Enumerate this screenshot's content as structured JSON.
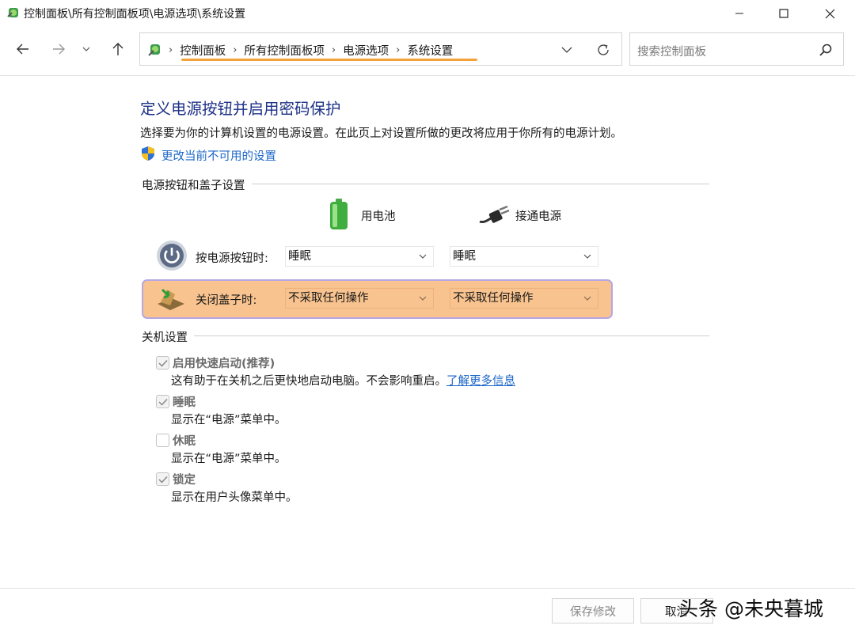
{
  "window": {
    "title": "控制面板\\所有控制面板项\\电源选项\\系统设置"
  },
  "nav": {
    "crumbs": [
      "控制面板",
      "所有控制面板项",
      "电源选项",
      "系统设置"
    ],
    "search_placeholder": "搜索控制面板"
  },
  "main": {
    "heading": "定义电源按钮并启用密码保护",
    "description": "选择要为你的计算机设置的电源设置。在此页上对设置所做的更改将应用于你所有的电源计划。",
    "change_link": "更改当前不可用的设置"
  },
  "power_section": {
    "title": "电源按钮和盖子设置",
    "col_battery": "用电池",
    "col_plugged": "接通电源",
    "rows": [
      {
        "label": "按电源按钮时:",
        "battery": "睡眠",
        "plugged": "睡眠"
      },
      {
        "label": "关闭盖子时:",
        "battery": "不采取任何操作",
        "plugged": "不采取任何操作"
      }
    ]
  },
  "shutdown_section": {
    "title": "关机设置",
    "items": [
      {
        "label": "启用快速启动(推荐)",
        "checked": true,
        "desc": "这有助于在关机之后更快地启动电脑。不会影响重启。",
        "link": "了解更多信息"
      },
      {
        "label": "睡眠",
        "checked": true,
        "desc": "显示在“电源”菜单中。"
      },
      {
        "label": "休眠",
        "checked": false,
        "desc": "显示在“电源”菜单中。"
      },
      {
        "label": "锁定",
        "checked": true,
        "desc": "显示在用户头像菜单中。"
      }
    ]
  },
  "footer": {
    "save_label": "保存修改",
    "cancel_label": "取消"
  },
  "watermark": "头条 @未央暮城",
  "icons": {
    "app": "control-panel-icon",
    "shield": "uac-shield-icon",
    "battery": "battery-icon",
    "plug": "power-plug-icon",
    "power_button": "power-button-icon",
    "lid": "laptop-lid-icon"
  },
  "colors": {
    "heading": "#1e3287",
    "link": "#1a66c7",
    "highlight_fill": "#f8c38e",
    "highlight_border": "#b6a6e3",
    "breadcrumb_underline": "#f4a23a"
  }
}
